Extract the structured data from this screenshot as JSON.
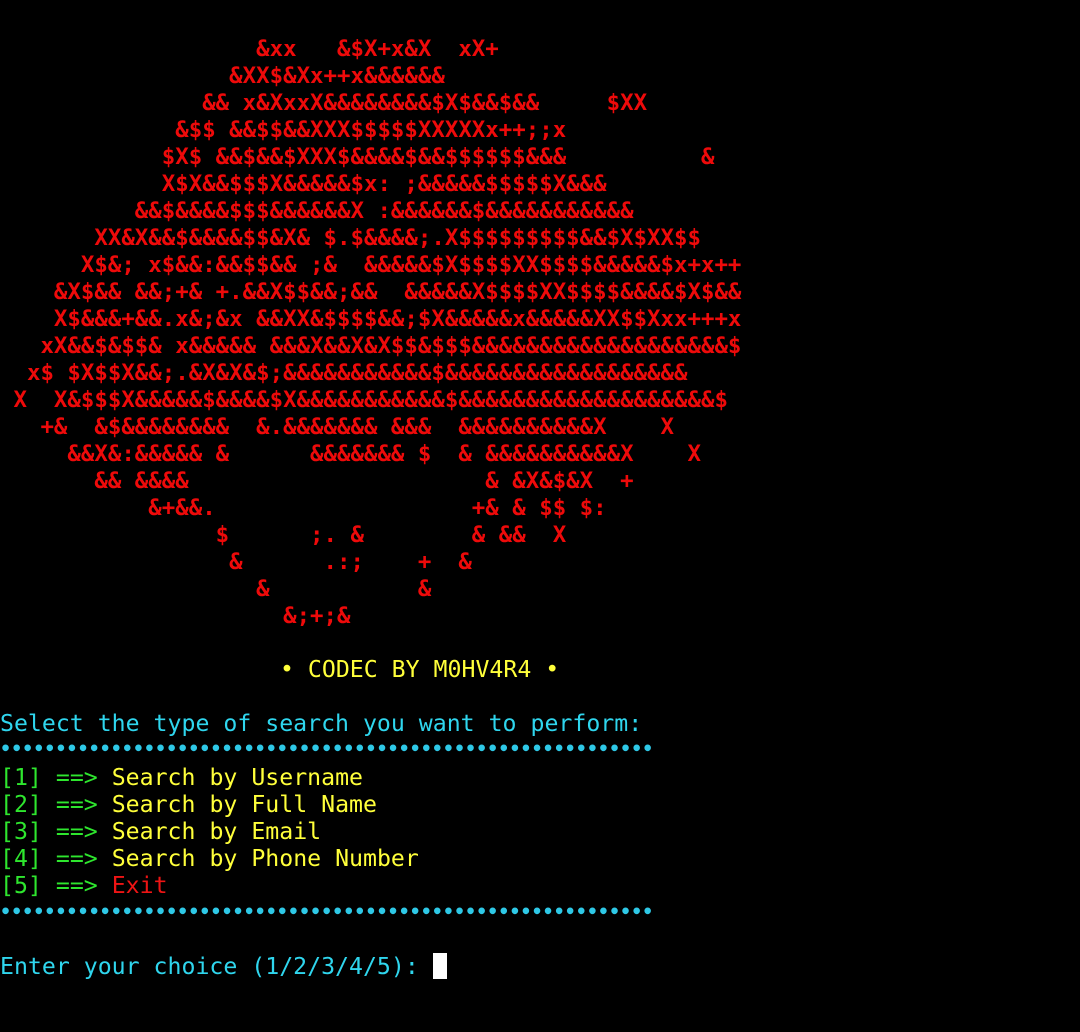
{
  "ascii_art": [
    "                   &xx   &$X+x&X  xX+",
    "                 &XX$&Xx++x&&&&&&",
    "               && x&XxxX&&&&&&&&$X$&&$&&     $XX",
    "             &$$ &&$$&&XXX$$$$$XXXXXx++;;x",
    "            $X$ &&$&&$XXX$&&&&$&&$$$$$$&&&          &",
    "            X$X&&$$$X&&&&&$x: ;&&&&&$$$$$X&&&",
    "          &&$&&&&$$$&&&&&&X :&&&&&&$&&&&&&&&&&&",
    "       XX&X&&$&&&&$$&X& $.$&&&&;.X$$$$$$$$$&&$X$XX$$",
    "      X$&; x$&&:&&$$&& ;&  &&&&&$X$$$$XX$$$$&&&&&$x+x++",
    "    &X$&& &&;+& +.&&X$$&&;&&  &&&&&X$$$$XX$$$$&&&&$X$&&",
    "    X$&&&+&&.x&;&x &&XX&$$$$&&;$X&&&&&x&&&&&XX$$Xxx+++x",
    "   xX&&$&$$& x&&&&& &&&X&&X&X$$&$$$&&&&&&&&&&&&&&&&&&&$",
    "  x$ $X$$X&&;.&X&X&$;&&&&&&&&&&&$&&&&&&&&&&&&&&&&&&",
    " X  X&$$$X&&&&&$&&&&$X&&&&&&&&&&&$&&&&&&&&&&&&&&&&&&&$",
    "   +&  &$&&&&&&&&  &.&&&&&&& &&&  &&&&&&&&&&X    X",
    "     &&X&:&&&&& &      &&&&&&& $  & &&&&&&&&&&X    X",
    "       && &&&&                      & &X&$&X  +",
    "           &+&&.                   +& & $$ $:",
    "                $      ;. &        & &&  X",
    "                 &      .:;    +  &",
    "                   &           &",
    "                     &;+;&"
  ],
  "banner": "• CODEC BY M0HV4R4 •",
  "prompt_heading": "Select the type of search you want to perform:",
  "separator": "•••••••••••••••••••••••••••••••••••••••••••••••••••••••••••",
  "menu": [
    {
      "index": "[1]",
      "arrow": "==>",
      "label": "Search by Username"
    },
    {
      "index": "[2]",
      "arrow": "==>",
      "label": "Search by Full Name"
    },
    {
      "index": "[3]",
      "arrow": "==>",
      "label": "Search by Email"
    },
    {
      "index": "[4]",
      "arrow": "==>",
      "label": "Search by Phone Number"
    },
    {
      "index": "[5]",
      "arrow": "==>",
      "label": "Exit"
    }
  ],
  "input_prompt": "Enter your choice (1/2/3/4/5): ",
  "input_value": "",
  "colors": {
    "background": "#000000",
    "art": "#ee0a0a",
    "banner": "#ffff3a",
    "heading": "#2fd6ee",
    "menu_index": "#2ee62e",
    "menu_label": "#ffff3a",
    "exit_label": "#ee1414"
  }
}
